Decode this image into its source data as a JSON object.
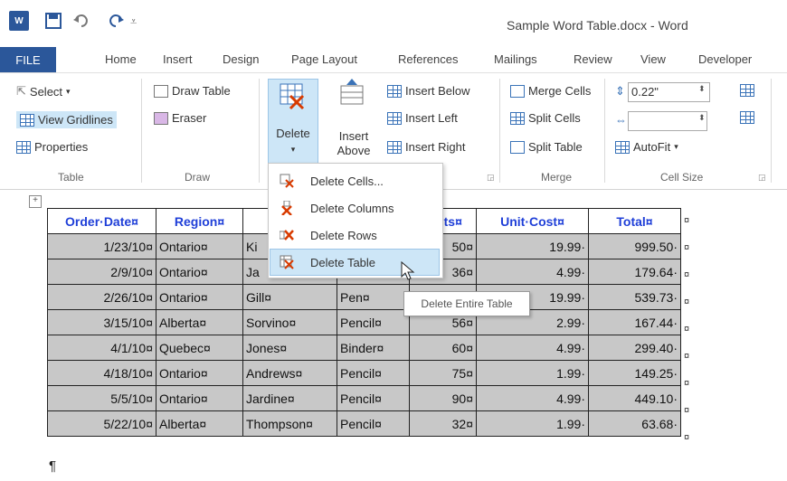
{
  "window": {
    "title": "Sample Word Table.docx - Word"
  },
  "tabs": [
    "FILE",
    "Home",
    "Insert",
    "Design",
    "Page Layout",
    "References",
    "Mailings",
    "Review",
    "View",
    "Developer"
  ],
  "ribbon": {
    "table_group": {
      "label": "Table",
      "select": "Select",
      "view_gridlines": "View Gridlines",
      "properties": "Properties"
    },
    "draw_group": {
      "label": "Draw",
      "draw_table": "Draw Table",
      "eraser": "Eraser"
    },
    "rows_group": {
      "delete": "Delete",
      "insert_above_1": "Insert",
      "insert_above_2": "Above",
      "insert_below": "Insert Below",
      "insert_left": "Insert Left",
      "insert_right": "Insert Right"
    },
    "merge_group": {
      "label": "Merge",
      "merge_cells": "Merge Cells",
      "split_cells": "Split Cells",
      "split_table": "Split Table"
    },
    "cell_size_group": {
      "label": "Cell Size",
      "height_value": "0.22\"",
      "width_value": "",
      "autofit": "AutoFit"
    }
  },
  "delete_menu": {
    "items": [
      "Delete Cells...",
      "Delete Columns",
      "Delete Rows",
      "Delete Table"
    ]
  },
  "tooltip": "Delete Entire Table",
  "table": {
    "headers": [
      "Order·Date¤",
      "Region¤",
      "",
      "",
      "Units¤",
      "Unit·Cost¤",
      "Total¤"
    ],
    "rows": [
      [
        "1/23/10¤",
        "Ontario¤",
        "Ki",
        "",
        "50¤",
        "19.99·",
        "999.50·"
      ],
      [
        "2/9/10¤",
        "Ontario¤",
        "Ja",
        "",
        "36¤",
        "4.99·",
        "179.64·"
      ],
      [
        "2/26/10¤",
        "Ontario¤",
        "Gill¤",
        "Pen¤",
        "",
        "19.99·",
        "539.73·"
      ],
      [
        "3/15/10¤",
        "Alberta¤",
        "Sorvino¤",
        "Pencil¤",
        "56¤",
        "2.99·",
        "167.44·"
      ],
      [
        "4/1/10¤",
        "Quebec¤",
        "Jones¤",
        "Binder¤",
        "60¤",
        "4.99·",
        "299.40·"
      ],
      [
        "4/18/10¤",
        "Ontario¤",
        "Andrews¤",
        "Pencil¤",
        "75¤",
        "1.99·",
        "149.25·"
      ],
      [
        "5/5/10¤",
        "Ontario¤",
        "Jardine¤",
        "Pencil¤",
        "90¤",
        "4.99·",
        "449.10·"
      ],
      [
        "5/22/10¤",
        "Alberta¤",
        "Thompson¤",
        "Pencil¤",
        "32¤",
        "1.99·",
        "63.68·"
      ]
    ]
  },
  "pilcrow": "¶"
}
